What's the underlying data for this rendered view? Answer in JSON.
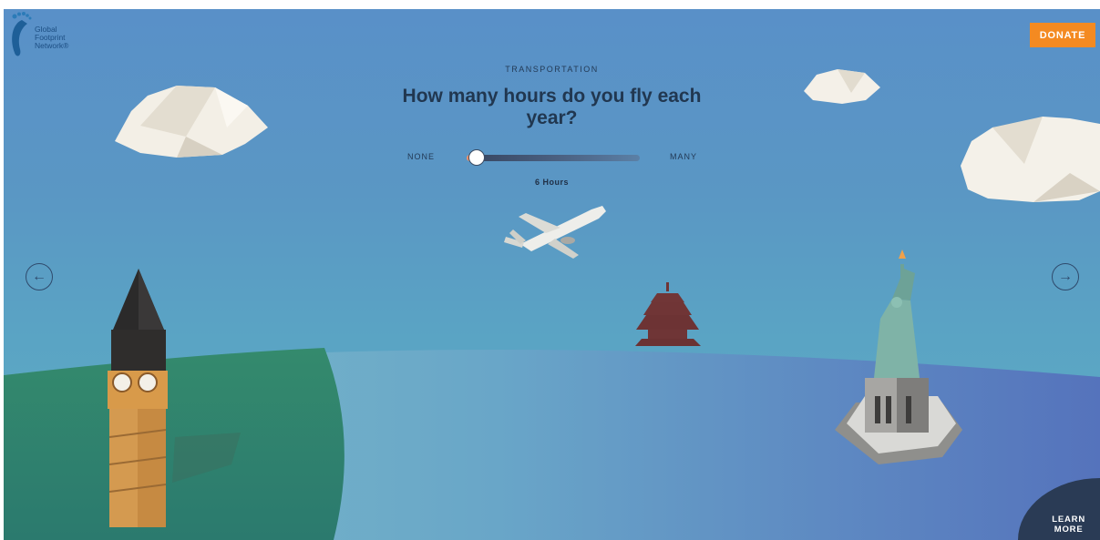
{
  "logo": {
    "line1": "Global",
    "line2": "Footprint",
    "line3": "Network®"
  },
  "donate_label": "DONATE",
  "category": "TRANSPORTATION",
  "question": "How many hours do you fly each year?",
  "slider": {
    "min_label": "NONE",
    "max_label": "MANY",
    "value_text": "6 Hours",
    "fraction": 0.05
  },
  "nav": {
    "prev_icon": "arrow-left-icon",
    "next_icon": "arrow-right-icon"
  },
  "learn_more": {
    "line1": "LEARN",
    "line2": "MORE"
  },
  "colors": {
    "accent": "#f48a21",
    "text": "#213750",
    "sky": "#5990c8",
    "ground": "#2f8873"
  }
}
